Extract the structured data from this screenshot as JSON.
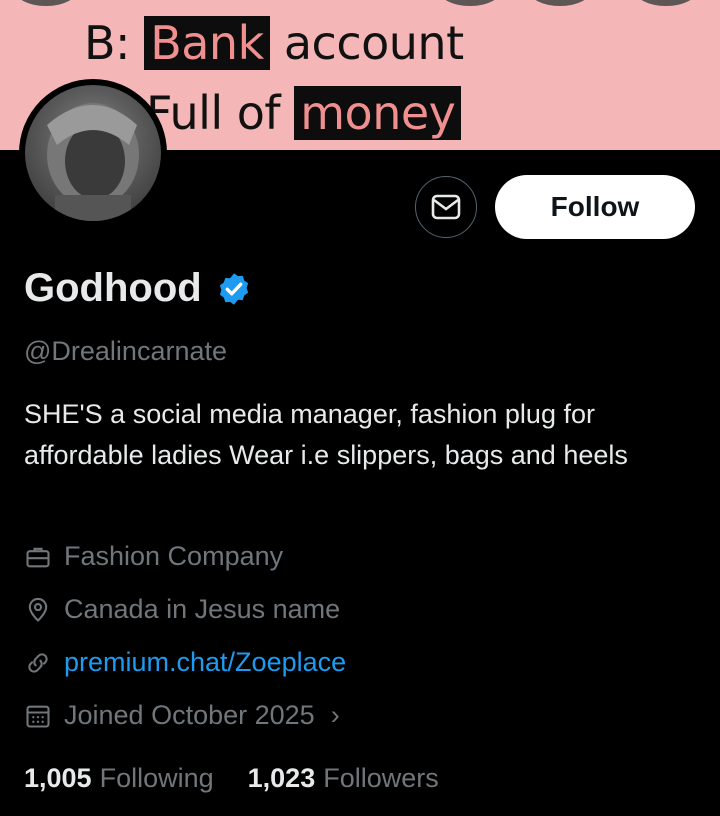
{
  "banner": {
    "line1_prefix": "B:",
    "line1_highlight": "Bank",
    "line1_suffix": "account",
    "line2_prefix": "Full of",
    "line2_highlight": "money",
    "background_color": "#f4b6b6",
    "highlight_color": "#ef8f8f"
  },
  "profile": {
    "name": "Godhood",
    "verified_icon": "verified-badge-icon",
    "handle": "@Drealincarnate",
    "bio": "SHE'S a social media manager, fashion plug for affordable ladies Wear i.e slippers, bags and heels"
  },
  "actions": {
    "message_icon": "envelope-icon",
    "follow_label": "Follow"
  },
  "meta": {
    "company": "Fashion Company",
    "location": "Canada in Jesus name",
    "link": "premium.chat/Zoeplace",
    "joined": "Joined October 2025",
    "chevron": "›"
  },
  "stats": {
    "following_count": "1,005",
    "following_label": "Following",
    "followers_count": "1,023",
    "followers_label": "Followers"
  },
  "colors": {
    "accent": "#1d9bf0",
    "muted": "#71767b",
    "text": "#e7e9ea"
  }
}
